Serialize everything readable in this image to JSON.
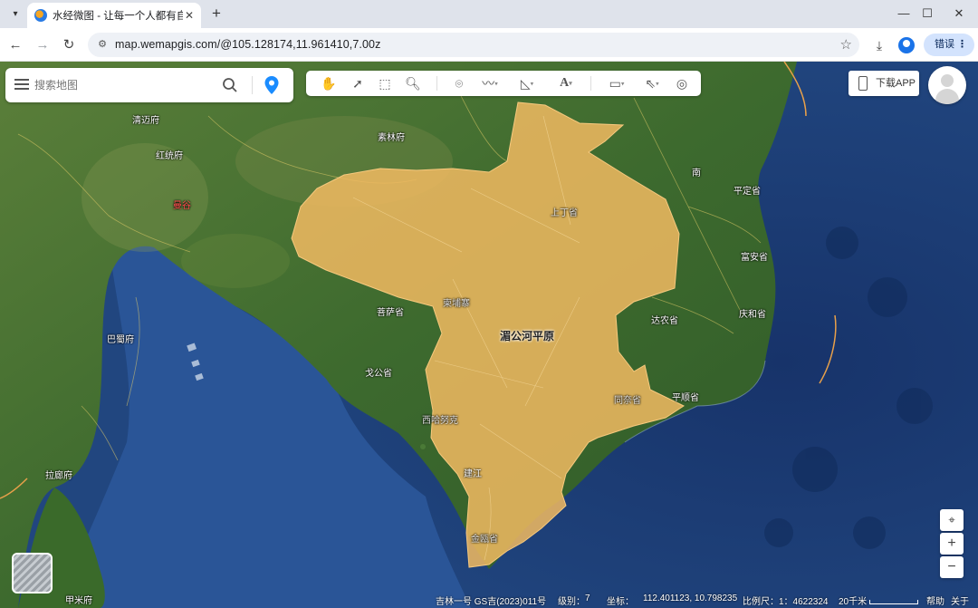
{
  "browser": {
    "tab_title": "水经微图 - 让每一个人都有自己",
    "url": "map.wemapgis.com/@105.128174,11.961410,7.00z",
    "profile_label": "错误"
  },
  "search": {
    "placeholder": "搜索地图"
  },
  "toolbar": {
    "download_app": "下载APP"
  },
  "map": {
    "labels": {
      "qingmai": "清迈府",
      "hongtong": "红统府",
      "sulin": "素林府",
      "mangu": "曼谷",
      "nan": "南",
      "pingding": "平定省",
      "fuan": "富安省",
      "shangding": "上丁省",
      "jianpuzhai": "柬埔寨",
      "ganbo": "菩萨省",
      "dale": "达农省",
      "qinghe": "庆和省",
      "meigong": "湄公河平原",
      "bashu": "巴蜀府",
      "gekong": "戈公省",
      "pingshun": "平顺省",
      "tongnai": "同奈省",
      "jianjiang": "建江",
      "gezhou": "金瓯省",
      "lamu": "拉廊府",
      "jiami": "甲米府",
      "sihanuk": "西哈努克"
    }
  },
  "status": {
    "provider": "吉林一号 GS吉(2023)011号",
    "level_label": "级别：",
    "level": "7",
    "coord_label": "坐标：",
    "coord": "112.401123, 10.798235",
    "scale_label": "比例尺：",
    "scale": "1：4622324",
    "distance": "20千米",
    "help": "帮助",
    "close": "关于"
  },
  "colors": {
    "highlight": "#f0b961",
    "sea": "#1d3f77",
    "land": "#3c6a2c"
  }
}
